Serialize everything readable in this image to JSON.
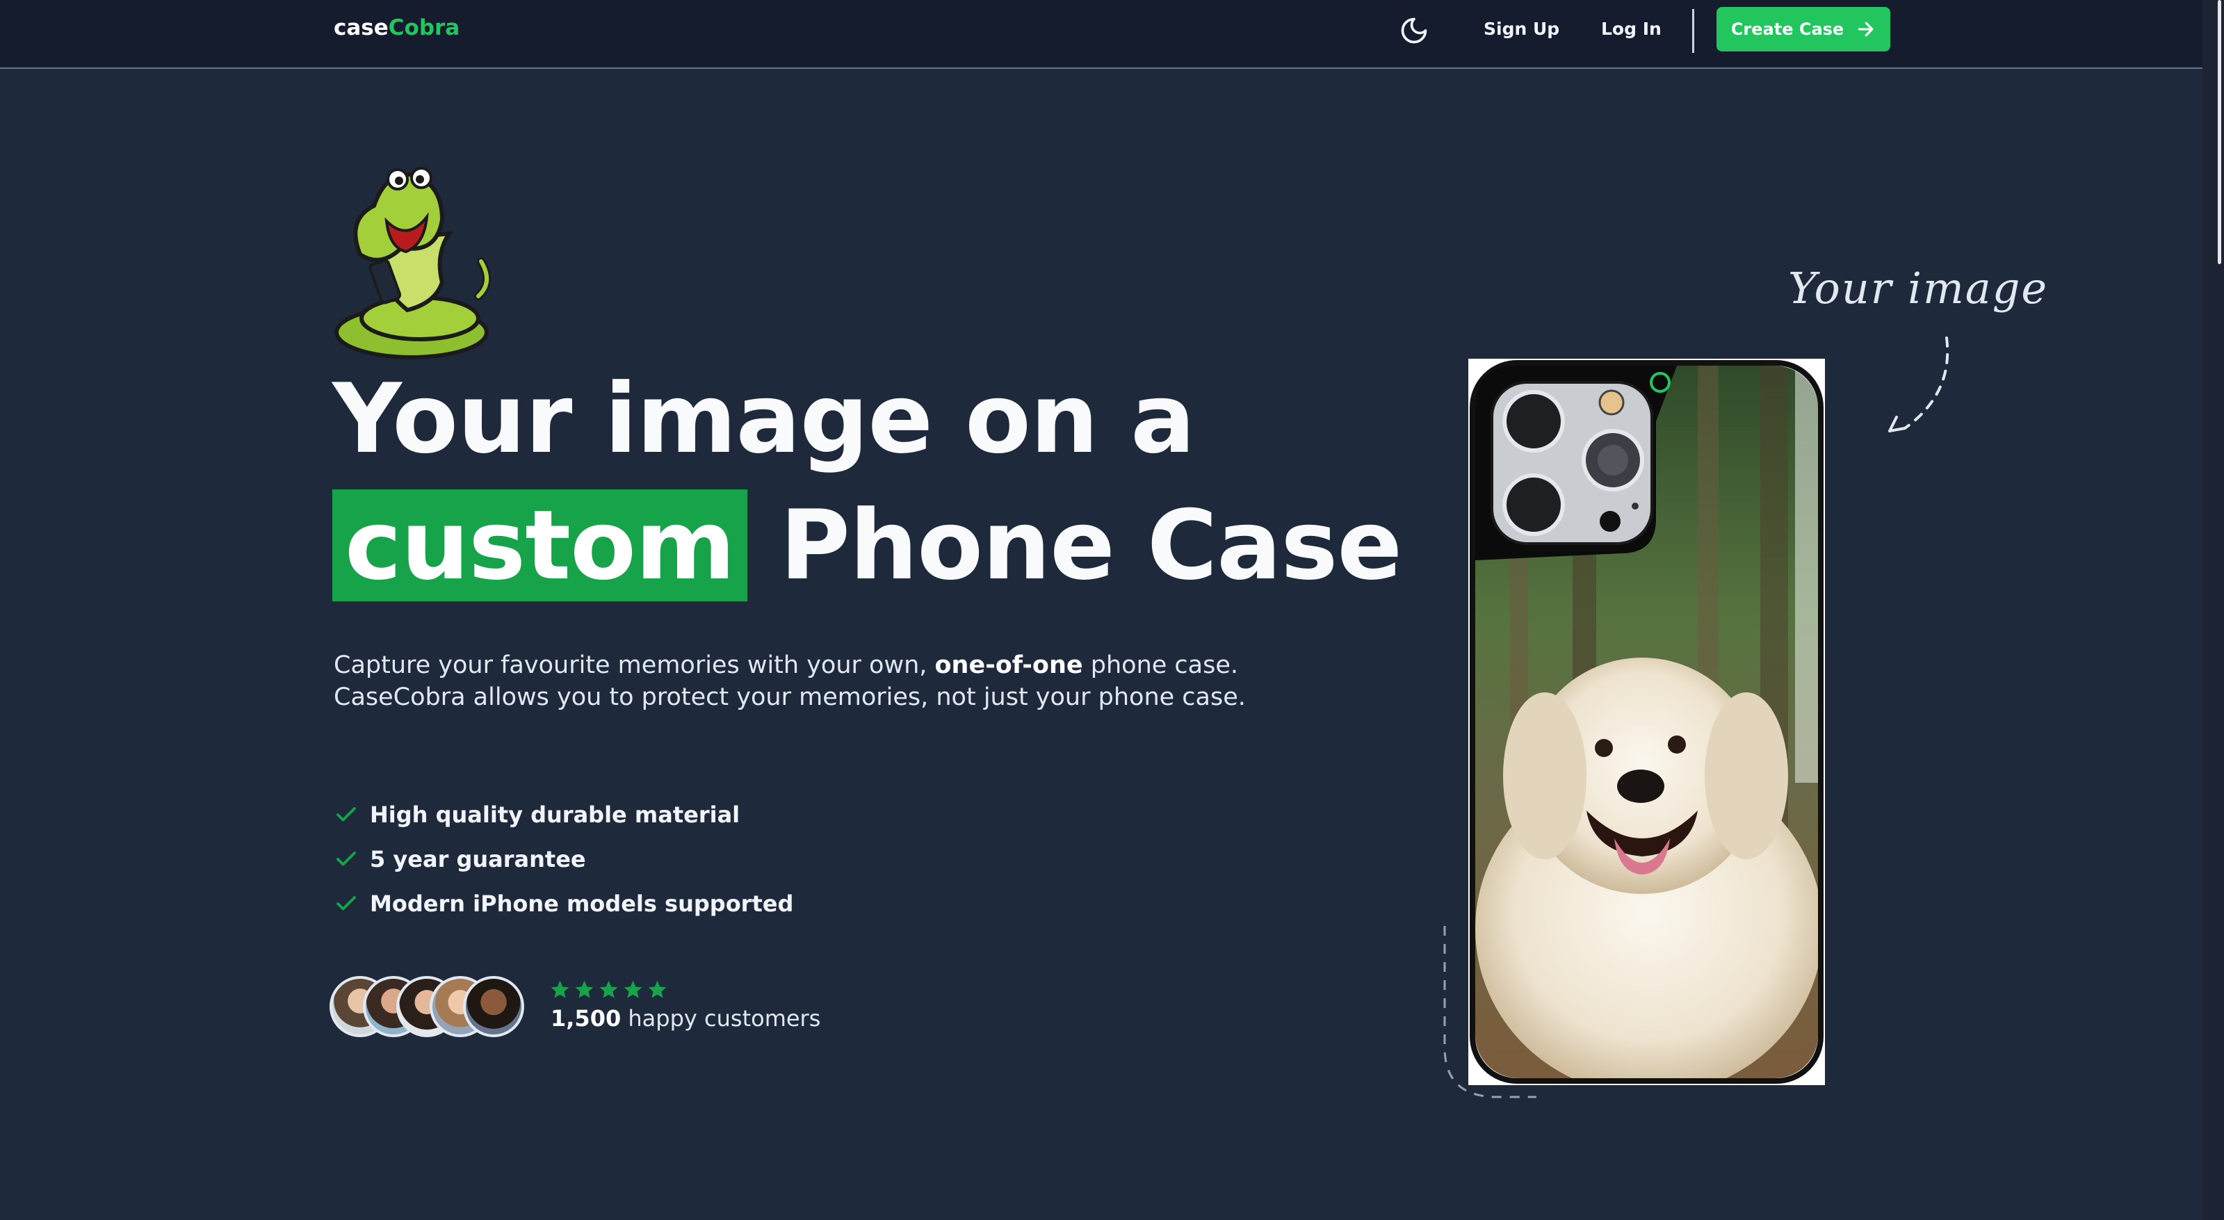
{
  "nav": {
    "logo_prefix": "case",
    "logo_suffix": "Cobra",
    "signup_label": "Sign Up",
    "login_label": "Log In",
    "cta_label": "Create Case",
    "theme_icon": "moon-icon",
    "cta_icon": "arrow-right-icon"
  },
  "hero": {
    "mascot_icon": "cobra-mascot-icon",
    "headline_line1": "Your image on a",
    "headline_highlight": "custom",
    "headline_rest": "Phone Case",
    "lead_before": "Capture your favourite memories with your own, ",
    "lead_bold": "one-of-one",
    "lead_after": " phone case. CaseCobra allows you to protect your memories, not just your phone case.",
    "features": [
      "High quality durable material",
      "5 year guarantee",
      "Modern iPhone models supported"
    ],
    "feature_icon": "check-icon",
    "rating_stars": 5,
    "customers_count": "1,500",
    "customers_text": " happy customers"
  },
  "showcase": {
    "callout_text": "Your image",
    "phone_image": "phone-case-with-dog-photo"
  },
  "colors": {
    "background": "#1e293b",
    "nav_background": "#141c2e",
    "accent": "#22c55e",
    "highlight": "#16a34a"
  }
}
